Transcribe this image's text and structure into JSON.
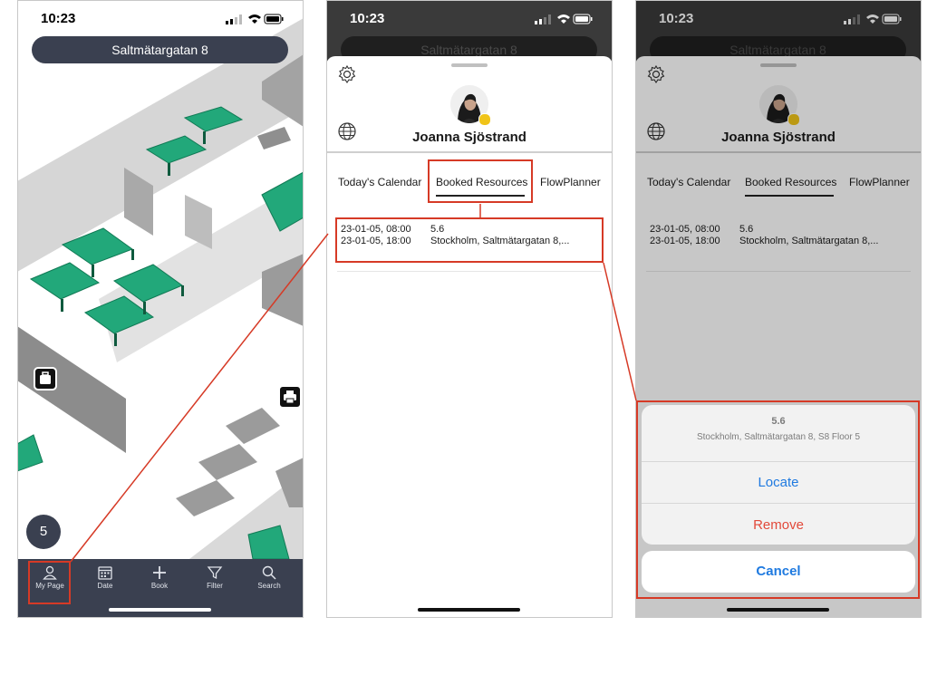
{
  "status_bar": {
    "time": "10:23"
  },
  "map_screen": {
    "location": "Saltmätargatan 8",
    "floor": "5",
    "tabs": [
      {
        "label": "My Page"
      },
      {
        "label": "Date"
      },
      {
        "label": "Book"
      },
      {
        "label": "Filter"
      },
      {
        "label": "Search"
      }
    ]
  },
  "profile_screen": {
    "background_location": "Saltmätargatan 8",
    "user_name": "Joanna Sjöstrand",
    "tabs": [
      {
        "label": "Today's Calendar"
      },
      {
        "label": "Booked Resources"
      },
      {
        "label": "FlowPlanner"
      }
    ],
    "booking": {
      "start": "23-01-05, 08:00",
      "end": "23-01-05, 18:00",
      "resource": "5.6",
      "place": "Stockholm, Saltmätargatan 8,..."
    }
  },
  "action_sheet": {
    "title": "5.6",
    "subtitle": "Stockholm, Saltmätargatan 8, S8 Floor 5",
    "locate": "Locate",
    "remove": "Remove",
    "cancel": "Cancel"
  },
  "colors": {
    "highlight": "#d63a26",
    "desk_green": "#22a87a",
    "nav_dark": "#3a4050",
    "link_blue": "#1f7ae0",
    "destructive_red": "#e2493a",
    "presence_yellow": "#f0c419"
  }
}
